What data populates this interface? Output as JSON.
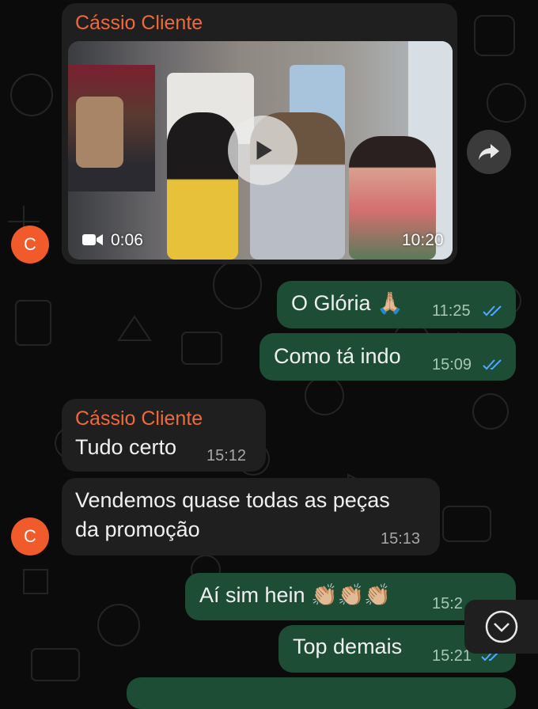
{
  "avatar_initial": "C",
  "video_message": {
    "sender": "Cássio Cliente",
    "duration": "0:06",
    "time": "10:20"
  },
  "messages": [
    {
      "text": "O Glória 🙏🏼",
      "time": "11:25"
    },
    {
      "text": "Como tá indo",
      "time": "15:09"
    },
    {
      "sender": "Cássio Cliente",
      "text": "Tudo certo",
      "time": "15:12"
    },
    {
      "text_line1": "Vendemos quase todas as peças",
      "text_line2": "da promoção",
      "time": "15:13"
    },
    {
      "text": "Aí sim hein 👏🏼👏🏼👏🏼",
      "time": "15:2"
    },
    {
      "text": "Top demais",
      "time": "15:21"
    }
  ],
  "icons": {
    "play": "play-icon",
    "camera": "video-camera-icon",
    "forward": "forward-icon",
    "scroll_down": "chevron-down-icon",
    "read": "double-check-icon"
  },
  "colors": {
    "incoming_bubble": "#1f1f1f",
    "outgoing_bubble": "#1e4d35",
    "sender_name": "#ee6a3a",
    "read_ticks": "#53a7ff",
    "avatar": "#f15a2a"
  }
}
